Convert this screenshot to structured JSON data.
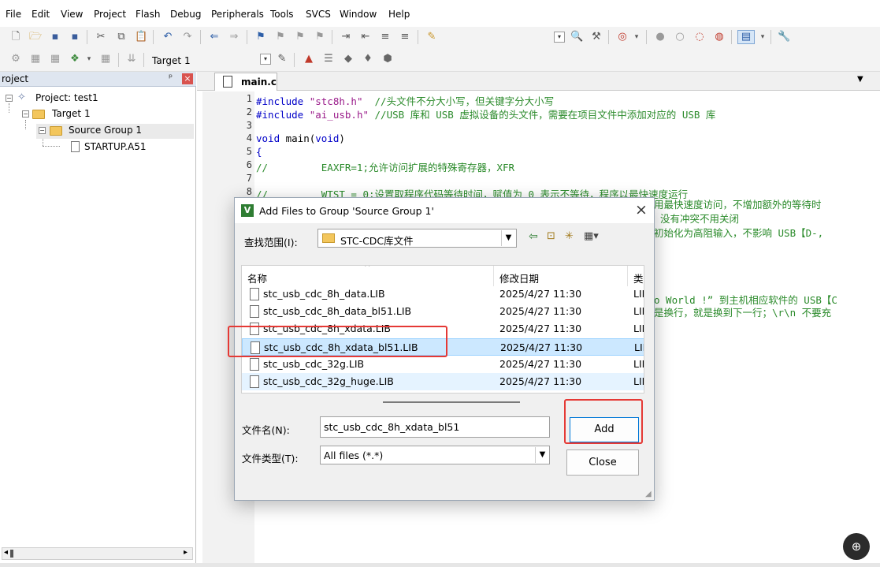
{
  "menubar": {
    "items": [
      "File",
      "Edit",
      "View",
      "Project",
      "Flash",
      "Debug",
      "Peripherals",
      "Tools",
      "SVCS",
      "Window",
      "Help"
    ]
  },
  "toolbar2": {
    "target_select": "Target 1"
  },
  "project_panel": {
    "title": "roject",
    "pin_glyph": "ᵖ",
    "close_glyph": "×",
    "tree": {
      "project": "Project: test1",
      "target": "Target 1",
      "group": "Source Group 1",
      "file": "STARTUP.A51"
    }
  },
  "editor": {
    "tab": "main.c",
    "lines": [
      {
        "n": "1",
        "segments": [
          {
            "t": "#include ",
            "c": "kw"
          },
          {
            "t": "\"stc8h.h\"",
            "c": "str"
          },
          {
            "t": "  //头文件不分大小写，但关键字分大小写",
            "c": "cm"
          }
        ]
      },
      {
        "n": "2",
        "segments": [
          {
            "t": "#include ",
            "c": "kw"
          },
          {
            "t": "\"ai_usb.h\"",
            "c": "str"
          },
          {
            "t": " //USB 库和 USB 虚拟设备的头文件，需要在项目文件中添加对应的 USB 库",
            "c": "cm"
          }
        ]
      },
      {
        "n": "3",
        "segments": []
      },
      {
        "n": "4",
        "segments": [
          {
            "t": "void",
            "c": "kw"
          },
          {
            "t": " main(",
            "c": ""
          },
          {
            "t": "void",
            "c": "kw"
          },
          {
            "t": ")",
            "c": ""
          }
        ]
      },
      {
        "n": "5",
        "segments": [
          {
            "t": "{",
            "c": "kw"
          }
        ]
      },
      {
        "n": "6",
        "segments": [
          {
            "t": "//         EAXFR=1;允许访问扩展的特殊寄存器，XFR",
            "c": "cm"
          }
        ]
      },
      {
        "n": "7",
        "segments": []
      },
      {
        "n": "8",
        "segments": [
          {
            "t": "//         WTST = 0;设置取程序代码等待时间，赋值为 0 表示不等待，程序以最快速度运行",
            "c": "cm"
          }
        ]
      }
    ],
    "overflow_lines": [
      "用最快速度访问，不增加额外的等待时",
      "没有冲突不用关闭",
      "初始化为高阻输入，不影响 USB【D-,",
      "o World !” 到主机相应软件的 USB【C",
      "是换行，就是换到下一行；\\r\\n 不要充"
    ]
  },
  "dialog": {
    "title": "Add Files to Group 'Source Group 1'",
    "close_glyph": "×",
    "lookin_label": "查找范围(I):",
    "lookin_value": "STC-CDC库文件",
    "columns": {
      "name": "名称",
      "date": "修改日期",
      "type": "类"
    },
    "files": [
      {
        "name": "stc_usb_cdc_8h_data.LIB",
        "date": "2025/4/27 11:30",
        "type": "LIE"
      },
      {
        "name": "stc_usb_cdc_8h_data_bl51.LIB",
        "date": "2025/4/27 11:30",
        "type": "LIE"
      },
      {
        "name": "stc_usb_cdc_8h_xdata.LIB",
        "date": "2025/4/27 11:30",
        "type": "LIE"
      },
      {
        "name": "stc_usb_cdc_8h_xdata_bl51.LIB",
        "date": "2025/4/27 11:30",
        "type": "LIE"
      },
      {
        "name": "stc_usb_cdc_32g.LIB",
        "date": "2025/4/27 11:30",
        "type": "LIE"
      },
      {
        "name": "stc_usb_cdc_32g_huge.LIB",
        "date": "2025/4/27 11:30",
        "type": "LIE"
      }
    ],
    "selected_index": 3,
    "filename_label": "文件名(N):",
    "filename_value": "stc_usb_cdc_8h_xdata_bl51",
    "filetype_label": "文件类型(T):",
    "filetype_value": "All files (*.*)",
    "add_label": "Add",
    "close_label": "Close"
  },
  "colors": {
    "selection": "#cce8ff",
    "highlight_box": "#e53935",
    "comment": "#2a8a2a",
    "keyword": "#0000c8",
    "string": "#9a1b8a"
  }
}
